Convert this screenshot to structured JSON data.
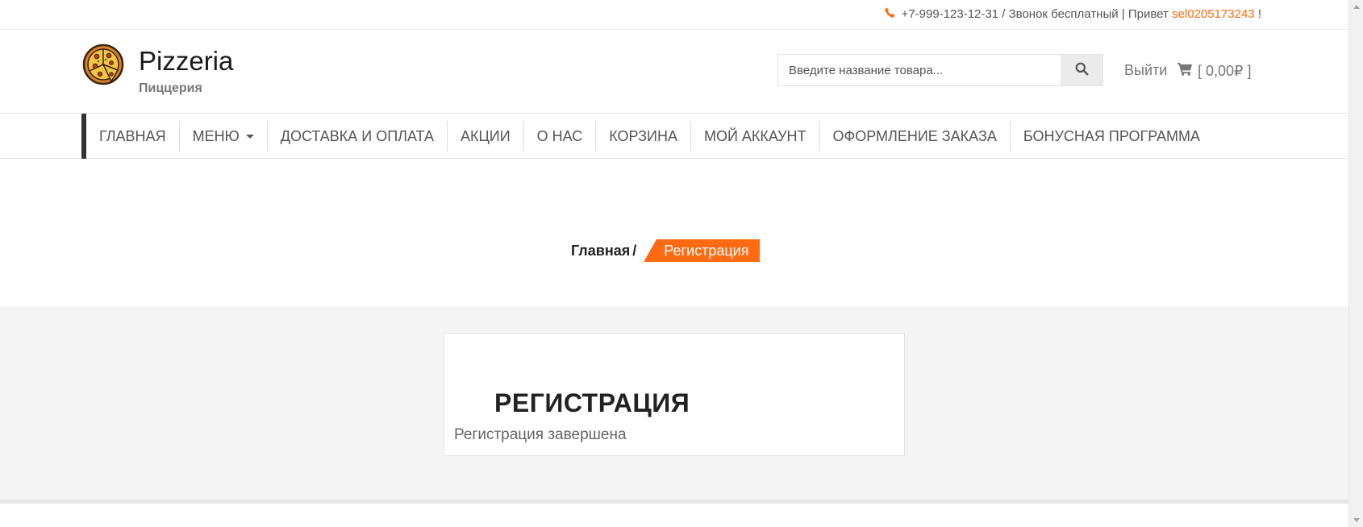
{
  "topbar": {
    "phone": "+7-999-123-12-31",
    "call_text": " / Звонок бесплатный | Привет ",
    "username": "sel0205173243",
    "suffix": " !"
  },
  "brand": {
    "title": "Pizzeria",
    "subtitle": "Пиццерия"
  },
  "search": {
    "placeholder": "Введите название товара..."
  },
  "header": {
    "logout_label": "Выйти",
    "cart_label": "[ 0,00₽ ]"
  },
  "nav": {
    "items": [
      {
        "label": "ГЛАВНАЯ"
      },
      {
        "label": "МЕНЮ"
      },
      {
        "label": "ДОСТАВКА И ОПЛАТА"
      },
      {
        "label": "АКЦИИ"
      },
      {
        "label": "О НАС"
      },
      {
        "label": "КОРЗИНА"
      },
      {
        "label": "МОЙ АККАУНТ"
      },
      {
        "label": "ОФОРМЛЕНИЕ ЗАКАЗА"
      },
      {
        "label": "БОНУСНАЯ ПРОГРАММА"
      }
    ]
  },
  "breadcrumb": {
    "home": "Главная",
    "separator": "/",
    "current": "Регистрация"
  },
  "main": {
    "title": "РЕГИСТРАЦИЯ",
    "message": "Регистрация завершена"
  },
  "icons": {
    "phone": "phone-icon",
    "logo": "pizza-logo-icon",
    "search": "search-icon",
    "cart": "cart-icon",
    "caret": "caret-down-icon"
  },
  "colors": {
    "accent": "#ff6a13",
    "content_bg": "#f4f4f4"
  }
}
